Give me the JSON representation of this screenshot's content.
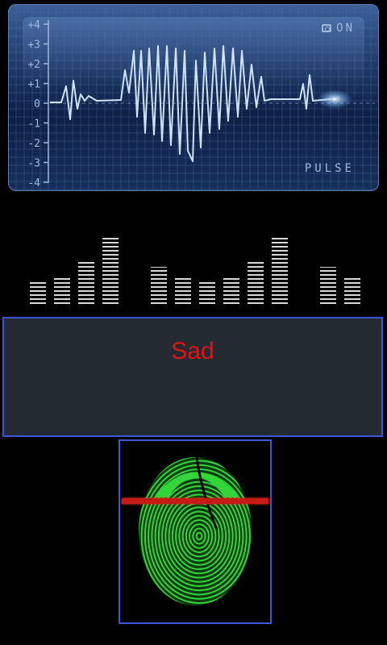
{
  "monitor": {
    "status_label": "ON",
    "camera_icon": "camera-icon",
    "pulse_label": "PULSE",
    "y_axis_ticks": [
      "+4",
      "+3",
      "+2",
      "+1",
      "0",
      "-1",
      "-2",
      "-3",
      "-4"
    ],
    "line_color": "#d8ecff"
  },
  "equalizer": {
    "bar_color": "#d7d7d7",
    "levels": [
      0.33,
      0.4,
      0.62,
      1.0,
      0,
      0.55,
      0.4,
      0.33,
      0.4,
      0.62,
      1.0,
      0,
      0.55,
      0.4
    ]
  },
  "mood": {
    "result": "Sad",
    "result_color": "#e01414"
  },
  "scanner": {
    "icon": "fingerprint-icon",
    "fingerprint_color": "#33d63a",
    "scan_line_color": "#c61a14"
  }
}
